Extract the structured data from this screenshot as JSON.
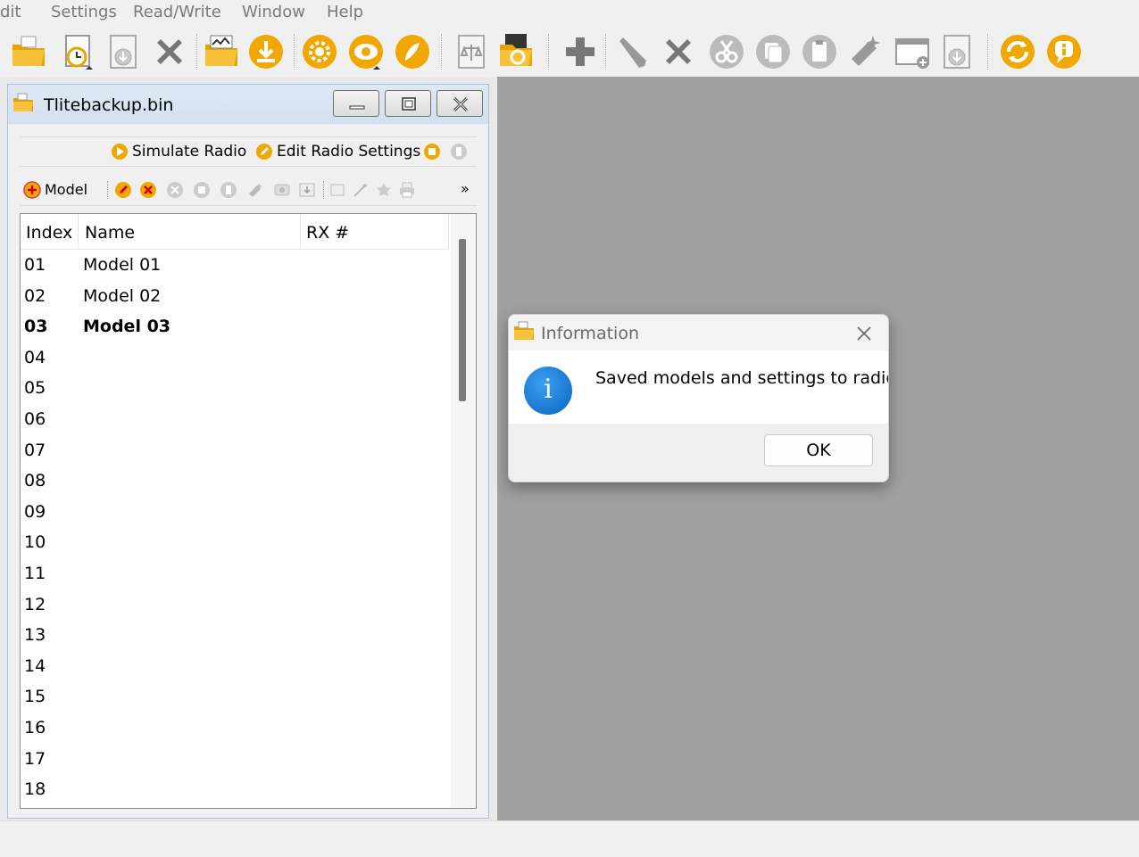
{
  "menubar": {
    "items": [
      "dit",
      "Settings",
      "Read/Write",
      "Window",
      "Help"
    ]
  },
  "toolbar": {
    "icons": [
      "open-folder-icon",
      "recent-files-icon",
      "save-icon",
      "close-icon",
      "open-logs-icon",
      "download-icon",
      "settings-icon",
      "profile-icon",
      "palette-icon",
      "compare-icon",
      "sdcard-sync-icon",
      "add-icon",
      "edit-icon",
      "delete-icon",
      "cut-icon",
      "copy-icon",
      "paste-icon",
      "wizard-icon",
      "add-window-icon",
      "save-all-icon",
      "sync-icon",
      "info-icon"
    ]
  },
  "subwindow": {
    "title": "Tlitebackup.bin",
    "actions": {
      "simulate": "Simulate Radio",
      "edit_settings": "Edit Radio Settings"
    },
    "model_toolbar": {
      "add_model": "Model",
      "overflow": "»"
    },
    "list": {
      "headers": {
        "index": "Index",
        "name": "Name",
        "rx": "RX #"
      },
      "rows": [
        {
          "index": "01",
          "name": "Model 01",
          "bold": false
        },
        {
          "index": "02",
          "name": "Model 02",
          "bold": false
        },
        {
          "index": "03",
          "name": "Model 03",
          "bold": true
        },
        {
          "index": "04",
          "name": "",
          "bold": false
        },
        {
          "index": "05",
          "name": "",
          "bold": false
        },
        {
          "index": "06",
          "name": "",
          "bold": false
        },
        {
          "index": "07",
          "name": "",
          "bold": false
        },
        {
          "index": "08",
          "name": "",
          "bold": false
        },
        {
          "index": "09",
          "name": "",
          "bold": false
        },
        {
          "index": "10",
          "name": "",
          "bold": false
        },
        {
          "index": "11",
          "name": "",
          "bold": false
        },
        {
          "index": "12",
          "name": "",
          "bold": false
        },
        {
          "index": "13",
          "name": "",
          "bold": false
        },
        {
          "index": "14",
          "name": "",
          "bold": false
        },
        {
          "index": "15",
          "name": "",
          "bold": false
        },
        {
          "index": "16",
          "name": "",
          "bold": false
        },
        {
          "index": "17",
          "name": "",
          "bold": false
        },
        {
          "index": "18",
          "name": "",
          "bold": false
        }
      ]
    }
  },
  "dialog": {
    "title": "Information",
    "message": "Saved models and settings to radio",
    "ok": "OK",
    "icon_glyph": "i"
  },
  "colors": {
    "accent_orange": "#f0a800",
    "mdi_background": "#a0a0a0",
    "info_blue": "#1577d4"
  }
}
